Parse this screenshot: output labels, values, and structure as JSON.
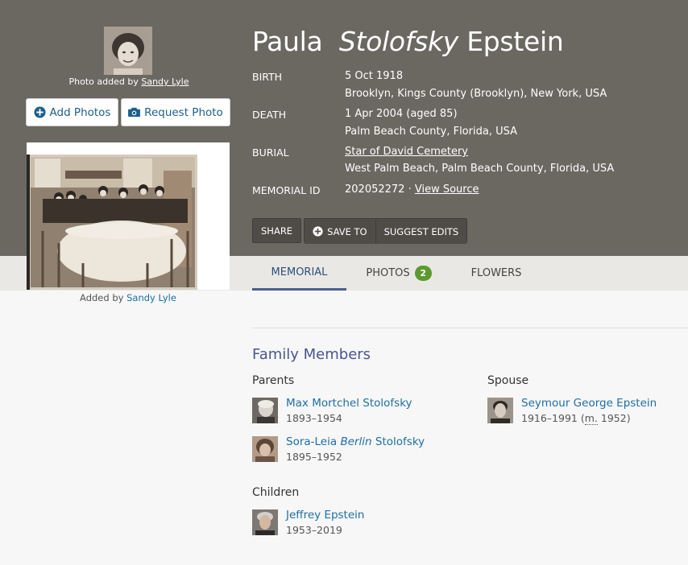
{
  "memorial": {
    "first_name": "Paula",
    "maiden_name": "Stolofsky",
    "last_name": "Epstein",
    "photo_added_prefix": "Photo added by",
    "photo_added_by": "Sandy Lyle",
    "add_photos_label": "Add Photos",
    "request_photo_label": "Request Photo",
    "main_photo_added_prefix": "Added by",
    "main_photo_added_by": "Sandy Lyle"
  },
  "facts": {
    "birth_label": "BIRTH",
    "birth_date": "5 Oct 1918",
    "birth_place": "Brooklyn, Kings County (Brooklyn), New York, USA",
    "death_label": "DEATH",
    "death_date": "1 Apr 2004 (aged 85)",
    "death_place": "Palm Beach County, Florida, USA",
    "burial_label": "BURIAL",
    "burial_cemetery": "Star of David Cemetery",
    "burial_place": "West Palm Beach, Palm Beach County, Florida, USA",
    "memorial_id_label": "MEMORIAL ID",
    "memorial_id": "202052272",
    "view_source": "View Source"
  },
  "actions": {
    "share": "SHARE",
    "save_to": "SAVE TO",
    "suggest_edits": "SUGGEST EDITS"
  },
  "tabs": {
    "memorial": "MEMORIAL",
    "photos": "PHOTOS",
    "photos_count": "2",
    "flowers": "FLOWERS"
  },
  "family": {
    "title": "Family Members",
    "parents_label": "Parents",
    "spouse_label": "Spouse",
    "children_label": "Children",
    "parents": [
      {
        "name": "Max Mortchel Stolofsky",
        "dates": "1893–1954"
      },
      {
        "first": "Sora-Leia",
        "maiden": "Berlin",
        "last": "Stolofsky",
        "dates": "1895–1952"
      }
    ],
    "spouse": {
      "name": "Seymour George Epstein",
      "dates": "1916–1991",
      "married_abbr": "m.",
      "married_year": "1952"
    },
    "children": [
      {
        "name": "Jeffrey Epstein",
        "dates": "1953–2019"
      }
    ]
  },
  "colors": {
    "hero_bg": "#6b6862",
    "link": "#1d6fa5",
    "badge": "#5a9a2f",
    "section_title": "#4a5590"
  }
}
